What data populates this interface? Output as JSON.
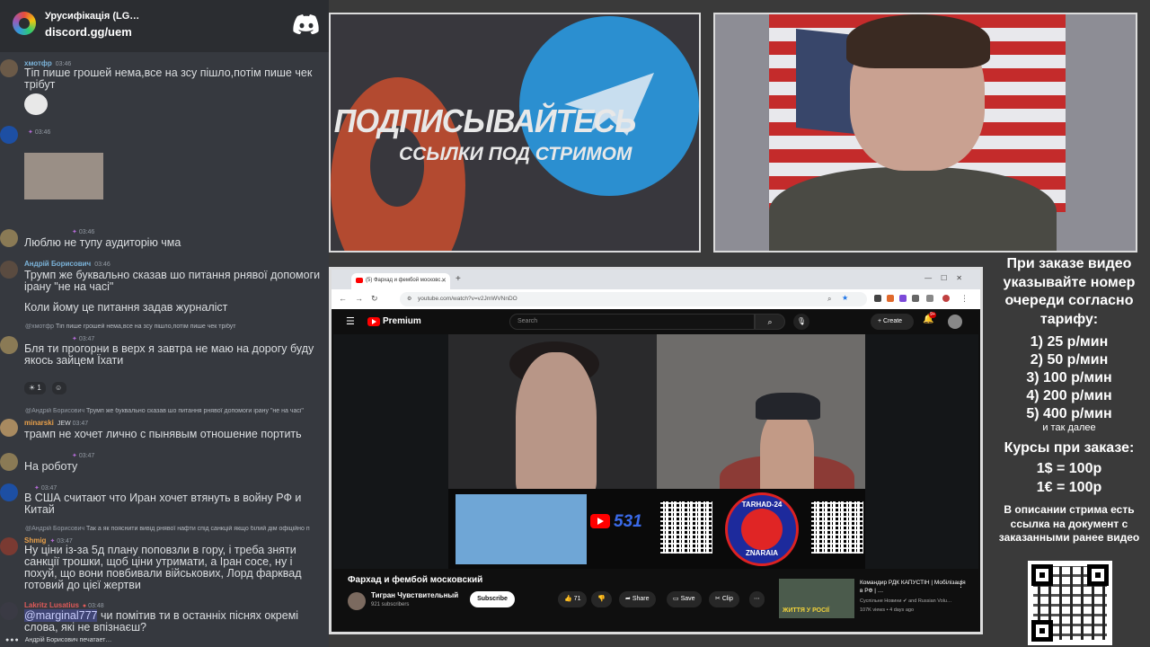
{
  "chat": {
    "server_name": "Урусифікація (LG…",
    "server_link": "discord.gg/uem",
    "messages": [
      {
        "user": "хмотфр",
        "time": "03:46",
        "text": "Тіп пише грошей нема,все на зсу пішло,потім пише чек трібут"
      },
      {
        "user": "",
        "time": "03:46",
        "text": ""
      },
      {
        "user": "",
        "time": "03:46",
        "text": "Люблю не тупу аудиторію чма"
      },
      {
        "user": "Андрій Борисович",
        "time": "03:46",
        "text": "Трумп же буквально сказав шо питання рнявої допомоги ірану \"не на часі\"",
        "text2": "Коли йому це питання задав журналіст"
      },
      {
        "reply_user": "@хмотфр",
        "reply": "Тіп пише грошей нема,все на зсу пішло,потім пише чек трібут",
        "user": "",
        "time": "03:47",
        "text": "Бля ти прогорни в верх я завтра не маю на дорогу буду якось зайцем Їхати",
        "reaction_count": "1"
      },
      {
        "reply_user": "@Андрій Борисович",
        "reply": "Трумп же буквально сказав шо питання рнявої допомоги ірану \"не на часі\"",
        "user": "minarski",
        "tag": "JEW",
        "time": "03:47",
        "text": "трамп не хочет лично с пынявым отношение портить"
      },
      {
        "user": "",
        "time": "03:47",
        "text": "На роботу"
      },
      {
        "user": "",
        "time": "03:47",
        "text": "В США считают что Иран хочет втянуть в войну РФ и Китай"
      },
      {
        "reply_user": "@Андрій Борисович",
        "reply": "Так а як пояснити вивід рнявої нафти спід санкцій якщо білий дім офіційно п",
        "user": "Shmig",
        "time": "03:47",
        "text": "Ну ціни із-за 5д плану поповзли в гору, і треба зняти санкції трошки, щоб ціни утримати, а Іран сосе, ну і похуй, що вони повбивали військових, Лорд фарквад готовий до цієї жертви"
      },
      {
        "user": "Lakritz Lusatius",
        "time": "03:48",
        "mention": "@marginal777",
        "text": " чи помітив ти в останніх піснях окремі слова, які не впізнаєш?"
      }
    ],
    "typing": "Андрій Борисович печатает…"
  },
  "banner": {
    "title": "ПОДПИСЫВАЙТЕСЬ",
    "subtitle": "ССЫЛКИ ПОД СТРИМОМ"
  },
  "browser": {
    "tab_title": "(5) Фархад и фембой московс…",
    "url": "youtube.com/watch?v=v2JmWVNnDO",
    "youtube": {
      "brand": "Premium",
      "search_placeholder": "Search",
      "create_label": "Create",
      "bell_count": "9+",
      "overlay_count": "531",
      "badge_top": "TARHAD-24",
      "badge_bottom": "ZNARAIA",
      "video_title": "Фархад и фембой московский",
      "channel_name": "Тигран Чувствительный",
      "subscribers": "921 subscribers",
      "subscribe_label": "Subscribe",
      "likes": "71",
      "share_label": "Share",
      "save_label": "Save",
      "clip_label": "Clip",
      "rec_title": "Командир РДК КАПУСТІН | Мобілізація в РФ | …",
      "rec_channel": "Суспільне Новини ✔ and Russian Volu…",
      "rec_meta": "107K views • 4 days ago",
      "rec_thumb_text": "ЖИТТЯ У РОСІЇ"
    }
  },
  "info": {
    "heading": "При заказе видео указывайте номер очереди согласно тарифу:",
    "tariffs": [
      "1) 25 р/мин",
      "2) 50 р/мин",
      "3) 100 р/мин",
      "4) 200 р/мин",
      "5) 400 р/мин"
    ],
    "tariff_more": "и так далее",
    "rates_heading": "Курсы при заказе:",
    "rates": [
      "1$ = 100р",
      "1€ = 100р"
    ],
    "description_note": "В описании стрима есть ссылка на документ с заказанными ранее видео"
  }
}
